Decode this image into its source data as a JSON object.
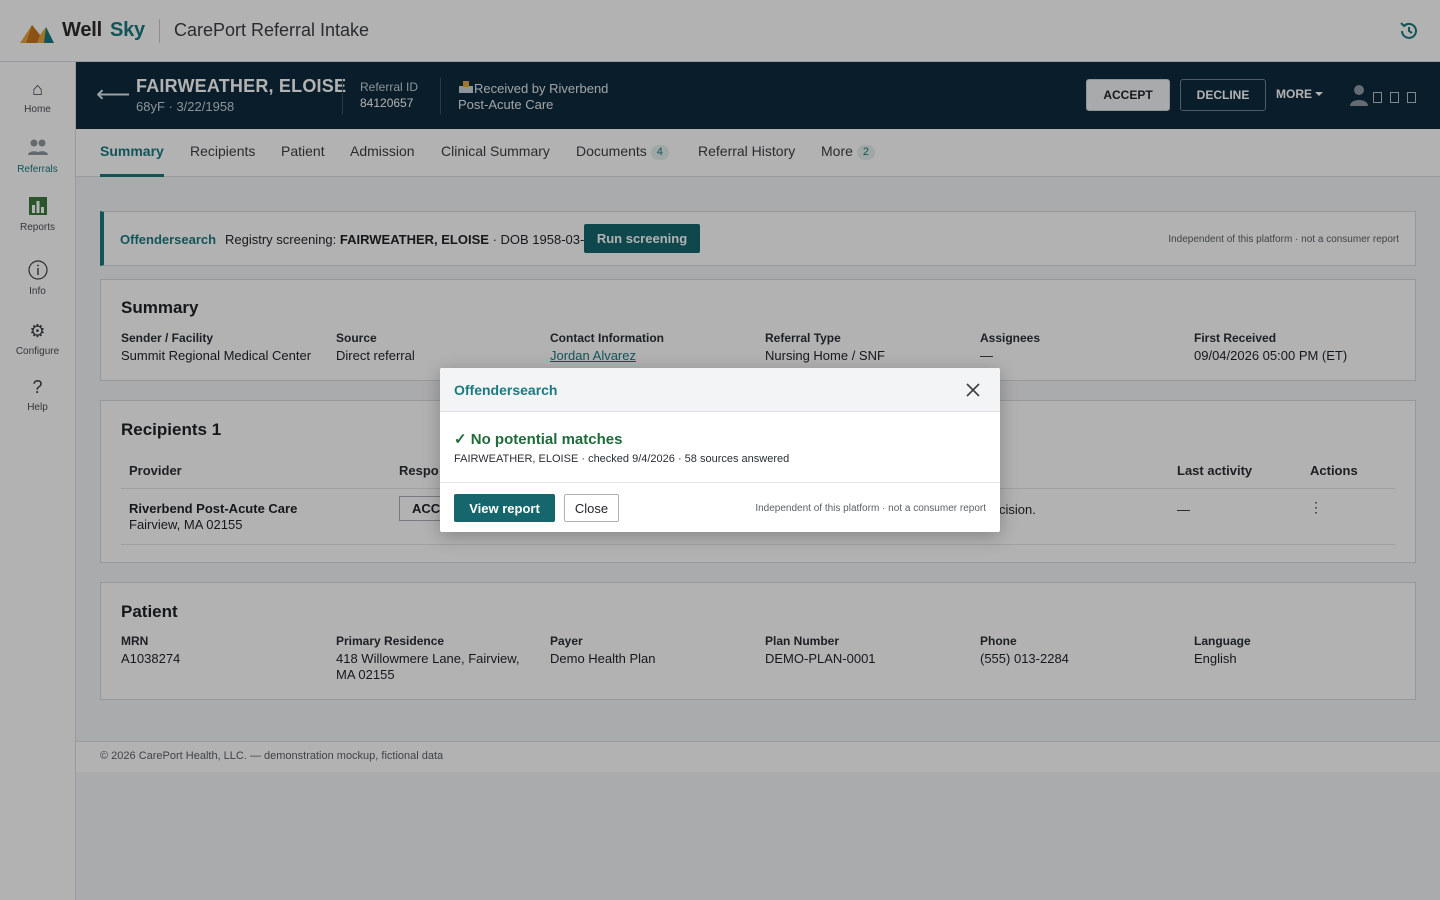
{
  "app": {
    "logo_well": "Well",
    "logo_sky": "Sky",
    "title": "CarePort Referral Intake"
  },
  "nav": [
    {
      "label": "Home",
      "icon": "home-icon"
    },
    {
      "label": "Referrals",
      "icon": "users-icon"
    },
    {
      "label": "Reports",
      "icon": "bar-chart-icon"
    },
    {
      "label": "Info",
      "icon": "info-icon"
    },
    {
      "label": "Configure",
      "icon": "gear-icon"
    },
    {
      "label": "Help",
      "icon": "help-icon"
    }
  ],
  "patient_header": {
    "name": "FAIRWEATHER, ELOISE",
    "sub": "68yF · 3/22/1958",
    "referral_id_label": "Referral ID",
    "referral_id": "84120657",
    "received_line1": "Received by Riverbend",
    "received_line2": "Post-Acute Care",
    "accept": "ACCEPT",
    "decline": "DECLINE",
    "more": "MORE"
  },
  "tabs": [
    {
      "label": "Summary",
      "active": true
    },
    {
      "label": "Recipients"
    },
    {
      "label": "Patient"
    },
    {
      "label": "Admission"
    },
    {
      "label": "Clinical Summary"
    },
    {
      "label": "Documents",
      "badge": "4"
    },
    {
      "label": "Referral History"
    },
    {
      "label": "More",
      "badge": "2"
    }
  ],
  "banner": {
    "brand": "Offendersearch",
    "text_prefix": "Registry screening:",
    "name": "FAIRWEATHER, ELOISE",
    "dob": "· DOB 1958-03-22",
    "button": "Run screening",
    "note": "Independent of this platform · not a consumer report"
  },
  "summary": {
    "title": "Summary",
    "fields": [
      {
        "label": "Sender / Facility",
        "value": "Summit Regional Medical Center"
      },
      {
        "label": "Source",
        "value": "Direct referral"
      },
      {
        "label": "Contact Information",
        "value": "Jordan Alvarez"
      },
      {
        "label": "Referral Type",
        "value": "Nursing Home / SNF"
      },
      {
        "label": "Assignees",
        "value": "—"
      },
      {
        "label": "First Received",
        "value": "09/04/2026 05:00 PM (ET)"
      }
    ]
  },
  "recipients": {
    "title": "Recipients 1",
    "headers": {
      "provider": "Provider",
      "response": "Respo",
      "last_activity": "Last activity",
      "actions": "Actions"
    },
    "row": {
      "provider_name": "Riverbend Post-Acute Care",
      "provider_addr": "Fairview, MA 02155",
      "response": "ACCI",
      "decision": "cision.",
      "last_activity": "—",
      "actions": "⋮"
    }
  },
  "patient": {
    "title": "Patient",
    "fields": [
      {
        "label": "MRN",
        "value": "A1038274"
      },
      {
        "label": "Primary Residence",
        "value": "418 Willowmere Lane, Fairview,",
        "value2": "MA 02155"
      },
      {
        "label": "Payer",
        "value": "Demo Health Plan"
      },
      {
        "label": "Plan Number",
        "value": "DEMO-PLAN-0001"
      },
      {
        "label": "Phone",
        "value": "(555) 013-2284"
      },
      {
        "label": "Language",
        "value": "English"
      }
    ]
  },
  "footer": {
    "text": "© 2026 CarePort Health, LLC. — demonstration mockup, fictional data"
  },
  "modal": {
    "title": "Offendersearch",
    "check": "✓",
    "result": "No potential matches",
    "detail": "FAIRWEATHER, ELOISE · checked 9/4/2026 · 58 sources answered",
    "view_report": "View report",
    "close": "Close",
    "note": "Independent of this platform · not a consumer report"
  },
  "colors": {
    "accent": "#1b7a80",
    "header_dark": "#0f2a3d",
    "success": "#1f6b3a"
  }
}
